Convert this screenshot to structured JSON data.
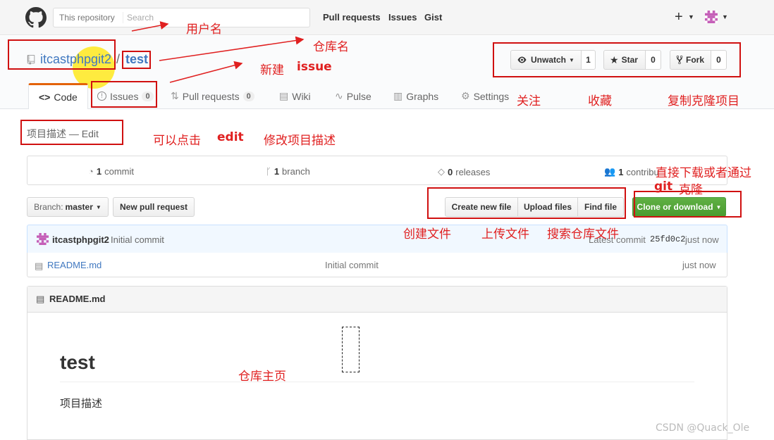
{
  "header": {
    "search_scope": "This repository",
    "search_placeholder": "Search",
    "nav": [
      "Pull requests",
      "Issues",
      "Gist"
    ],
    "plus": "+"
  },
  "repo": {
    "owner": "itcastphpgit2",
    "slash": "/",
    "name": "test",
    "watch_label": "Unwatch",
    "watch_count": "1",
    "star_label": "Star",
    "star_count": "0",
    "fork_label": "Fork",
    "fork_count": "0"
  },
  "tabs": {
    "code": "Code",
    "issues": "Issues",
    "issues_count": "0",
    "pulls": "Pull requests",
    "pulls_count": "0",
    "wiki": "Wiki",
    "pulse": "Pulse",
    "graphs": "Graphs",
    "settings": "Settings"
  },
  "description": {
    "text": "项目描述",
    "sep": "—",
    "edit": "Edit"
  },
  "summary": {
    "commits_num": "1",
    "commits_label": "commit",
    "branches_num": "1",
    "branches_label": "branch",
    "releases_num": "0",
    "releases_label": "releases",
    "contributors_num": "1",
    "contributors_label": "contribu"
  },
  "file_nav": {
    "branch_prefix": "Branch:",
    "branch_name": "master",
    "new_pr": "New pull request",
    "create_file": "Create new file",
    "upload_files": "Upload files",
    "find_file": "Find file",
    "clone": "Clone or download"
  },
  "commit": {
    "author": "itcastphpgit2",
    "message": "Initial commit",
    "latest_prefix": "Latest commit",
    "sha": "25fd0c2",
    "time": "just now"
  },
  "files": [
    {
      "name": "README.md",
      "message": "Initial commit",
      "age": "just now"
    }
  ],
  "readme": {
    "filename": "README.md",
    "title": "test",
    "body": "项目描述"
  },
  "annotations": {
    "username": "用户名",
    "repo_name": "仓库名",
    "new_issue_a": "新建",
    "new_issue_b": "issue",
    "watch": "关注",
    "star": "收藏",
    "fork": "复制克隆项目",
    "edit_a": "可以点击",
    "edit_b": "edit",
    "edit_c": "修改项目描述",
    "clone_a": "直接下载或者通过",
    "clone_b": "git",
    "clone_c": "克隆",
    "create": "创建文件",
    "upload": "上传文件",
    "search": "搜索仓库文件",
    "home": "仓库主页"
  },
  "watermark": "CSDN @Quack_Ole"
}
